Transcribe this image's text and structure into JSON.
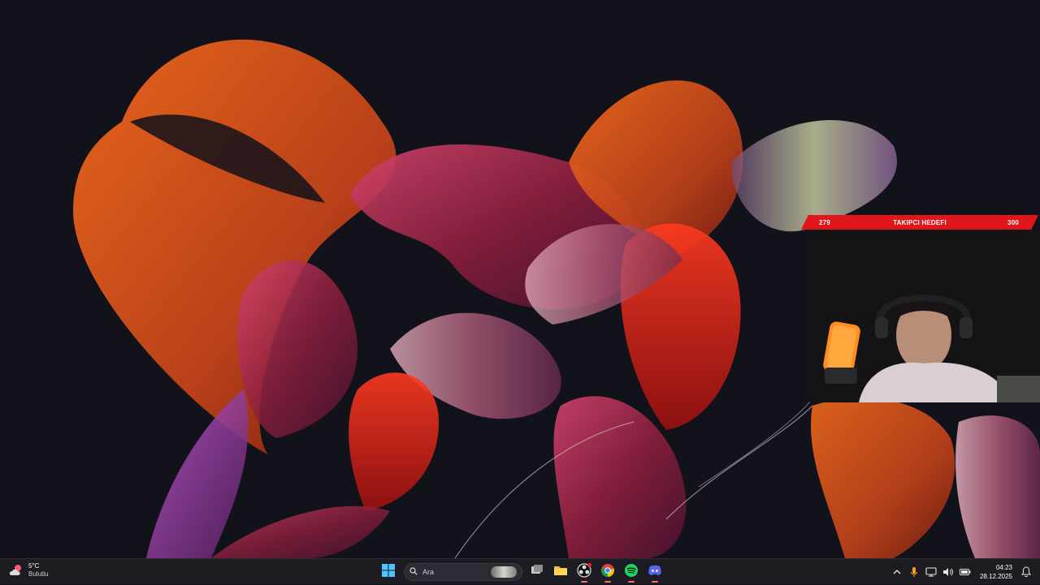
{
  "overlay": {
    "follower_goal": {
      "current": "279",
      "label": "TAKIPCI HEDEFI",
      "target": "300",
      "progress": 0.93
    }
  },
  "taskbar": {
    "weather": {
      "temp": "5°C",
      "condition": "Bulutlu",
      "icon": "cloudy-weather-icon"
    },
    "search": {
      "placeholder": "Ara"
    },
    "pinned_apps": [
      {
        "name": "start",
        "icon": "windows-logo-icon"
      },
      {
        "name": "task-view",
        "icon": "task-view-icon"
      },
      {
        "name": "file-explorer",
        "icon": "folder-icon"
      },
      {
        "name": "obs",
        "icon": "obs-icon",
        "active": true
      },
      {
        "name": "chrome",
        "icon": "chrome-icon",
        "active": true
      },
      {
        "name": "spotify",
        "icon": "spotify-icon",
        "active": true
      },
      {
        "name": "discord",
        "icon": "discord-icon",
        "active": true
      }
    ],
    "tray": {
      "icons": [
        "chevron-up-icon",
        "microphone-icon",
        "network-icon",
        "volume-icon",
        "battery-icon"
      ],
      "time": "04:23",
      "date": "28.12.2025"
    }
  },
  "colors": {
    "taskbar_bg": "#1c1c22",
    "overlay_red": "#e0161b",
    "active_indicator": "#ff6a6a"
  }
}
